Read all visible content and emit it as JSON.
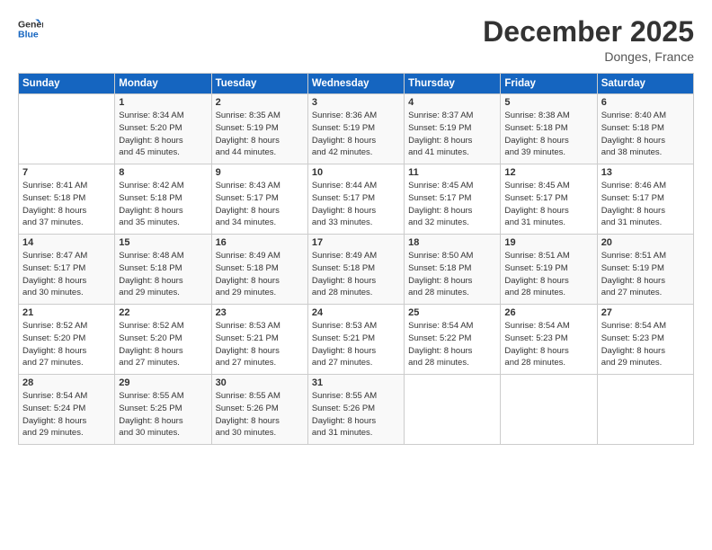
{
  "logo": {
    "line1": "General",
    "line2": "Blue"
  },
  "title": "December 2025",
  "location": "Donges, France",
  "days_header": [
    "Sunday",
    "Monday",
    "Tuesday",
    "Wednesday",
    "Thursday",
    "Friday",
    "Saturday"
  ],
  "weeks": [
    [
      {
        "day": "",
        "info": ""
      },
      {
        "day": "1",
        "info": "Sunrise: 8:34 AM\nSunset: 5:20 PM\nDaylight: 8 hours\nand 45 minutes."
      },
      {
        "day": "2",
        "info": "Sunrise: 8:35 AM\nSunset: 5:19 PM\nDaylight: 8 hours\nand 44 minutes."
      },
      {
        "day": "3",
        "info": "Sunrise: 8:36 AM\nSunset: 5:19 PM\nDaylight: 8 hours\nand 42 minutes."
      },
      {
        "day": "4",
        "info": "Sunrise: 8:37 AM\nSunset: 5:19 PM\nDaylight: 8 hours\nand 41 minutes."
      },
      {
        "day": "5",
        "info": "Sunrise: 8:38 AM\nSunset: 5:18 PM\nDaylight: 8 hours\nand 39 minutes."
      },
      {
        "day": "6",
        "info": "Sunrise: 8:40 AM\nSunset: 5:18 PM\nDaylight: 8 hours\nand 38 minutes."
      }
    ],
    [
      {
        "day": "7",
        "info": "Sunrise: 8:41 AM\nSunset: 5:18 PM\nDaylight: 8 hours\nand 37 minutes."
      },
      {
        "day": "8",
        "info": "Sunrise: 8:42 AM\nSunset: 5:18 PM\nDaylight: 8 hours\nand 35 minutes."
      },
      {
        "day": "9",
        "info": "Sunrise: 8:43 AM\nSunset: 5:17 PM\nDaylight: 8 hours\nand 34 minutes."
      },
      {
        "day": "10",
        "info": "Sunrise: 8:44 AM\nSunset: 5:17 PM\nDaylight: 8 hours\nand 33 minutes."
      },
      {
        "day": "11",
        "info": "Sunrise: 8:45 AM\nSunset: 5:17 PM\nDaylight: 8 hours\nand 32 minutes."
      },
      {
        "day": "12",
        "info": "Sunrise: 8:45 AM\nSunset: 5:17 PM\nDaylight: 8 hours\nand 31 minutes."
      },
      {
        "day": "13",
        "info": "Sunrise: 8:46 AM\nSunset: 5:17 PM\nDaylight: 8 hours\nand 31 minutes."
      }
    ],
    [
      {
        "day": "14",
        "info": "Sunrise: 8:47 AM\nSunset: 5:17 PM\nDaylight: 8 hours\nand 30 minutes."
      },
      {
        "day": "15",
        "info": "Sunrise: 8:48 AM\nSunset: 5:18 PM\nDaylight: 8 hours\nand 29 minutes."
      },
      {
        "day": "16",
        "info": "Sunrise: 8:49 AM\nSunset: 5:18 PM\nDaylight: 8 hours\nand 29 minutes."
      },
      {
        "day": "17",
        "info": "Sunrise: 8:49 AM\nSunset: 5:18 PM\nDaylight: 8 hours\nand 28 minutes."
      },
      {
        "day": "18",
        "info": "Sunrise: 8:50 AM\nSunset: 5:18 PM\nDaylight: 8 hours\nand 28 minutes."
      },
      {
        "day": "19",
        "info": "Sunrise: 8:51 AM\nSunset: 5:19 PM\nDaylight: 8 hours\nand 28 minutes."
      },
      {
        "day": "20",
        "info": "Sunrise: 8:51 AM\nSunset: 5:19 PM\nDaylight: 8 hours\nand 27 minutes."
      }
    ],
    [
      {
        "day": "21",
        "info": "Sunrise: 8:52 AM\nSunset: 5:20 PM\nDaylight: 8 hours\nand 27 minutes."
      },
      {
        "day": "22",
        "info": "Sunrise: 8:52 AM\nSunset: 5:20 PM\nDaylight: 8 hours\nand 27 minutes."
      },
      {
        "day": "23",
        "info": "Sunrise: 8:53 AM\nSunset: 5:21 PM\nDaylight: 8 hours\nand 27 minutes."
      },
      {
        "day": "24",
        "info": "Sunrise: 8:53 AM\nSunset: 5:21 PM\nDaylight: 8 hours\nand 27 minutes."
      },
      {
        "day": "25",
        "info": "Sunrise: 8:54 AM\nSunset: 5:22 PM\nDaylight: 8 hours\nand 28 minutes."
      },
      {
        "day": "26",
        "info": "Sunrise: 8:54 AM\nSunset: 5:23 PM\nDaylight: 8 hours\nand 28 minutes."
      },
      {
        "day": "27",
        "info": "Sunrise: 8:54 AM\nSunset: 5:23 PM\nDaylight: 8 hours\nand 29 minutes."
      }
    ],
    [
      {
        "day": "28",
        "info": "Sunrise: 8:54 AM\nSunset: 5:24 PM\nDaylight: 8 hours\nand 29 minutes."
      },
      {
        "day": "29",
        "info": "Sunrise: 8:55 AM\nSunset: 5:25 PM\nDaylight: 8 hours\nand 30 minutes."
      },
      {
        "day": "30",
        "info": "Sunrise: 8:55 AM\nSunset: 5:26 PM\nDaylight: 8 hours\nand 30 minutes."
      },
      {
        "day": "31",
        "info": "Sunrise: 8:55 AM\nSunset: 5:26 PM\nDaylight: 8 hours\nand 31 minutes."
      },
      {
        "day": "",
        "info": ""
      },
      {
        "day": "",
        "info": ""
      },
      {
        "day": "",
        "info": ""
      }
    ]
  ]
}
